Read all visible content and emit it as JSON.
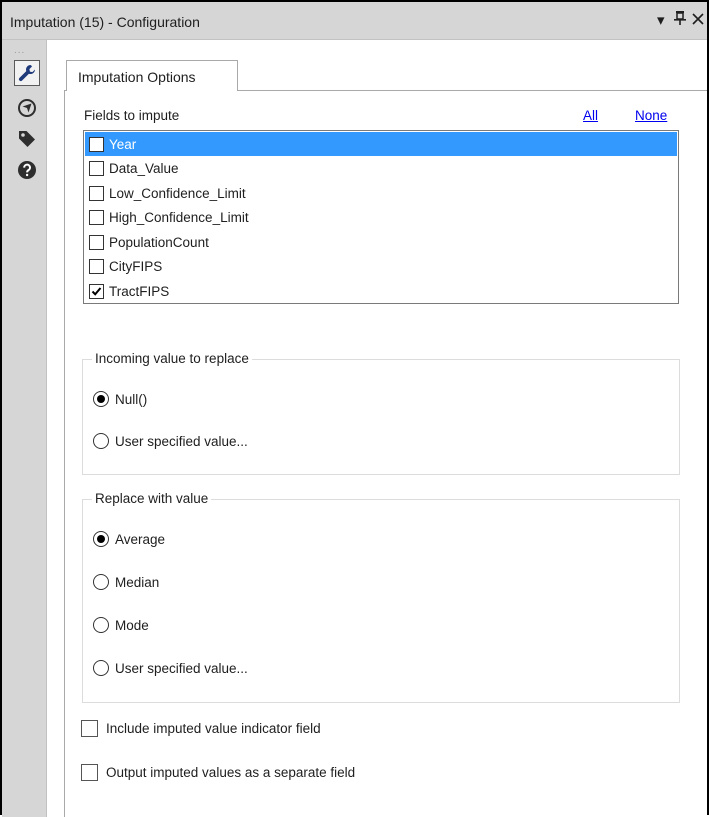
{
  "window": {
    "title": "Imputation (15) - Configuration",
    "dropdown_glyph": "▾",
    "pin_glyph": "⊥",
    "close_glyph": "✕"
  },
  "sidebar": {
    "grip": "...",
    "items": [
      {
        "name": "configuration-wrench-icon",
        "active": true
      },
      {
        "name": "output-navigation-icon",
        "active": false
      },
      {
        "name": "annotation-tag-icon",
        "active": false
      },
      {
        "name": "help-icon",
        "active": false
      }
    ]
  },
  "tab": {
    "label": "Imputation Options"
  },
  "fields": {
    "title": "Fields to impute",
    "all_link": "All",
    "none_link": "None",
    "items": [
      {
        "label": "Year",
        "checked": false,
        "selected": true
      },
      {
        "label": "Data_Value",
        "checked": false,
        "selected": false
      },
      {
        "label": "Low_Confidence_Limit",
        "checked": false,
        "selected": false
      },
      {
        "label": "High_Confidence_Limit",
        "checked": false,
        "selected": false
      },
      {
        "label": "PopulationCount",
        "checked": false,
        "selected": false
      },
      {
        "label": "CityFIPS",
        "checked": false,
        "selected": false
      },
      {
        "label": "TractFIPS",
        "checked": true,
        "selected": false
      }
    ]
  },
  "incoming": {
    "title": "Incoming value to replace",
    "options": [
      {
        "label": "Null()",
        "selected": true
      },
      {
        "label": "User specified value...",
        "selected": false
      }
    ]
  },
  "replace": {
    "title": "Replace with value",
    "options": [
      {
        "label": "Average",
        "selected": true
      },
      {
        "label": "Median",
        "selected": false
      },
      {
        "label": "Mode",
        "selected": false
      },
      {
        "label": "User specified value...",
        "selected": false
      }
    ]
  },
  "options": {
    "include_indicator": {
      "label": "Include imputed value indicator field",
      "checked": false
    },
    "separate_field": {
      "label": "Output imputed values as a separate field",
      "checked": false
    }
  },
  "colors": {
    "chrome": "#d6d6d6",
    "selection": "#3399ff",
    "link": "#0000ee"
  }
}
